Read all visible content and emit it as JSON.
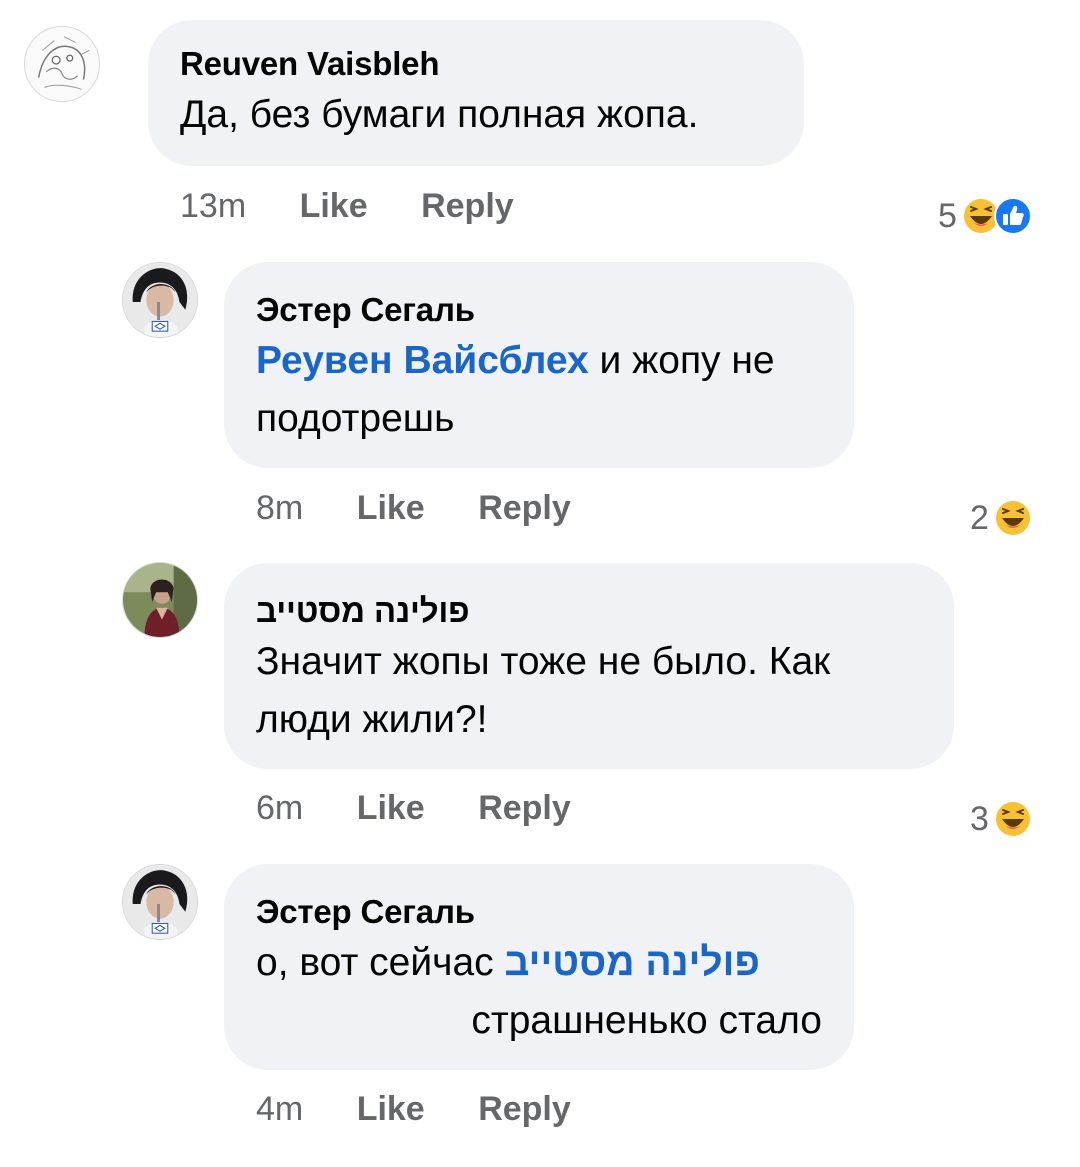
{
  "comments": [
    {
      "author": "Reuven Vaisbleh",
      "text_before": "Да, без бумаги полная жопа.",
      "time": "13m",
      "like_label": "Like",
      "reply_label": "Reply",
      "reaction_count": "5",
      "reactions": [
        "haha-icon",
        "like-icon"
      ]
    },
    {
      "author": "Эстер Сегаль",
      "mention": "Реувен Вайсблех",
      "text_after": " и жопу не подотрешь",
      "time": "8m",
      "like_label": "Like",
      "reply_label": "Reply",
      "reaction_count": "2",
      "reactions": [
        "haha-icon"
      ]
    },
    {
      "author": "פולינה מסטייב",
      "text_before": "Значит жопы тоже не было. Как люди жили?!",
      "time": "6m",
      "like_label": "Like",
      "reply_label": "Reply",
      "reaction_count": "3",
      "reactions": [
        "haha-icon"
      ]
    },
    {
      "author": "Эстер Сегаль",
      "text_before": "о, вот сейчас ",
      "mention": "פולינה מסטייב",
      "text_after": "страшненько стало",
      "time": "4m",
      "like_label": "Like",
      "reply_label": "Reply"
    }
  ],
  "colors": {
    "bubble": "#f0f2f5",
    "mention": "#1a66c8",
    "meta": "#65676b",
    "like_blue": "#1877f2",
    "haha_yellow": "#f7c136"
  }
}
